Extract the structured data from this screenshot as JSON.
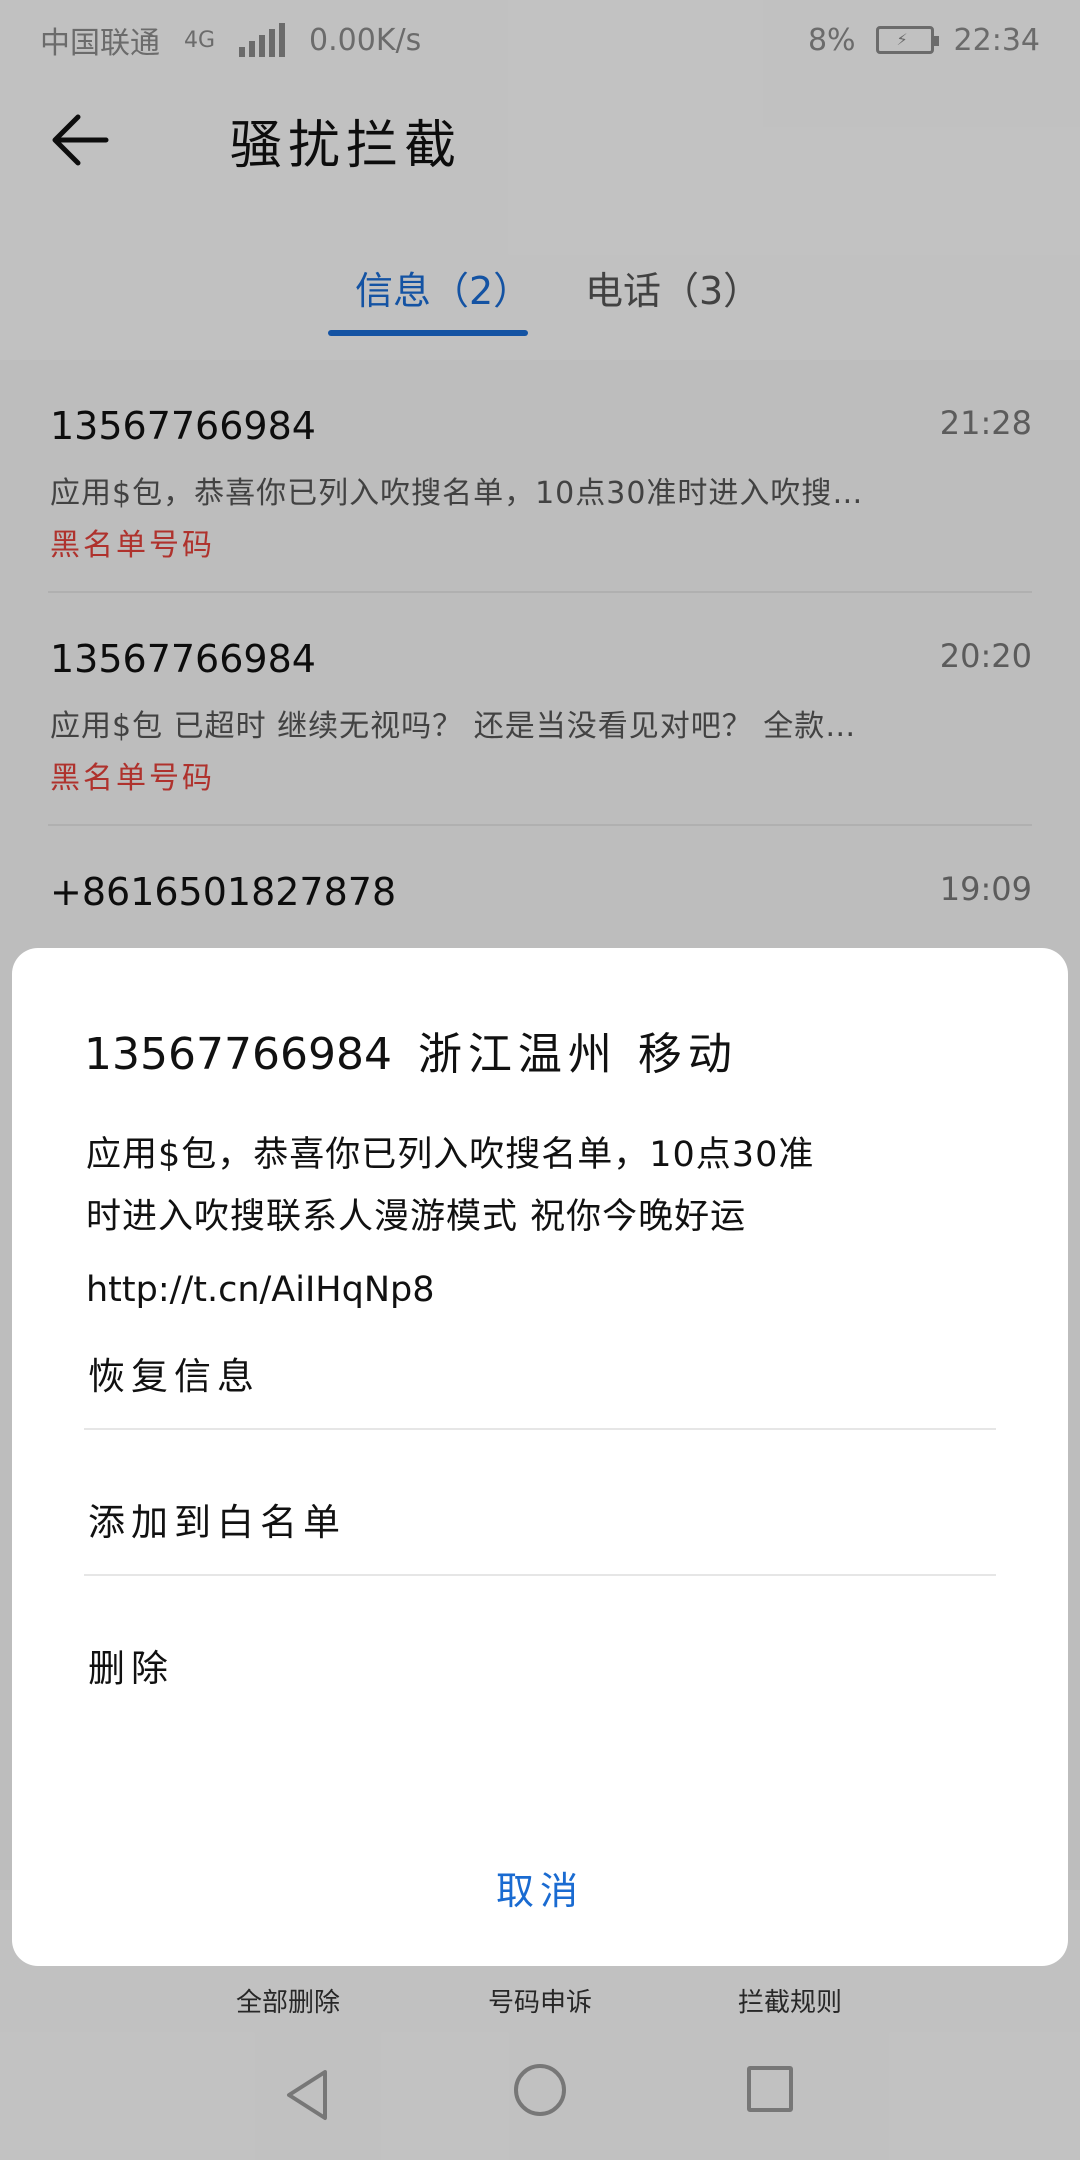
{
  "status_bar": {
    "carrier": "中国联通",
    "network": "4G",
    "speed": "0.00K/s",
    "battery": "8%",
    "time": "22:34"
  },
  "header": {
    "title": "骚扰拦截",
    "back_icon": "arrow-left-icon"
  },
  "tabs": [
    {
      "label": "信息（2）",
      "active": true
    },
    {
      "label": "电话（3）",
      "active": false
    }
  ],
  "messages": [
    {
      "number": "13567766984",
      "time": "21:28",
      "preview": "应用$包，恭喜你已列入吹搜名单，10点30准时进入吹搜…",
      "tag": "黑名单号码"
    },
    {
      "number": "13567766984",
      "time": "20:20",
      "preview": "应用$包 已超时 继续无视吗？ 还是当没看见对吧？ 全款…",
      "tag": "黑名单号码"
    },
    {
      "number": "+8616501827878",
      "time": "19:09",
      "preview": "",
      "tag": ""
    }
  ],
  "bottom_actions": [
    {
      "label": "全部删除"
    },
    {
      "label": "号码申诉"
    },
    {
      "label": "拦截规则"
    }
  ],
  "dialog": {
    "number": "13567766984",
    "location": "浙江温州 移动",
    "body_line1": "应用$包，恭喜你已列入吹搜名单，10点30准",
    "body_line2": "时进入吹搜联系人漫游模式 祝你今晚好运",
    "link": "http://t.cn/AiIHqNp8",
    "options": [
      "恢复信息",
      "添加到白名单",
      "删除"
    ],
    "cancel": "取消"
  },
  "colors": {
    "accent": "#1a6bd1",
    "blacklist_tag": "#e0403a"
  }
}
